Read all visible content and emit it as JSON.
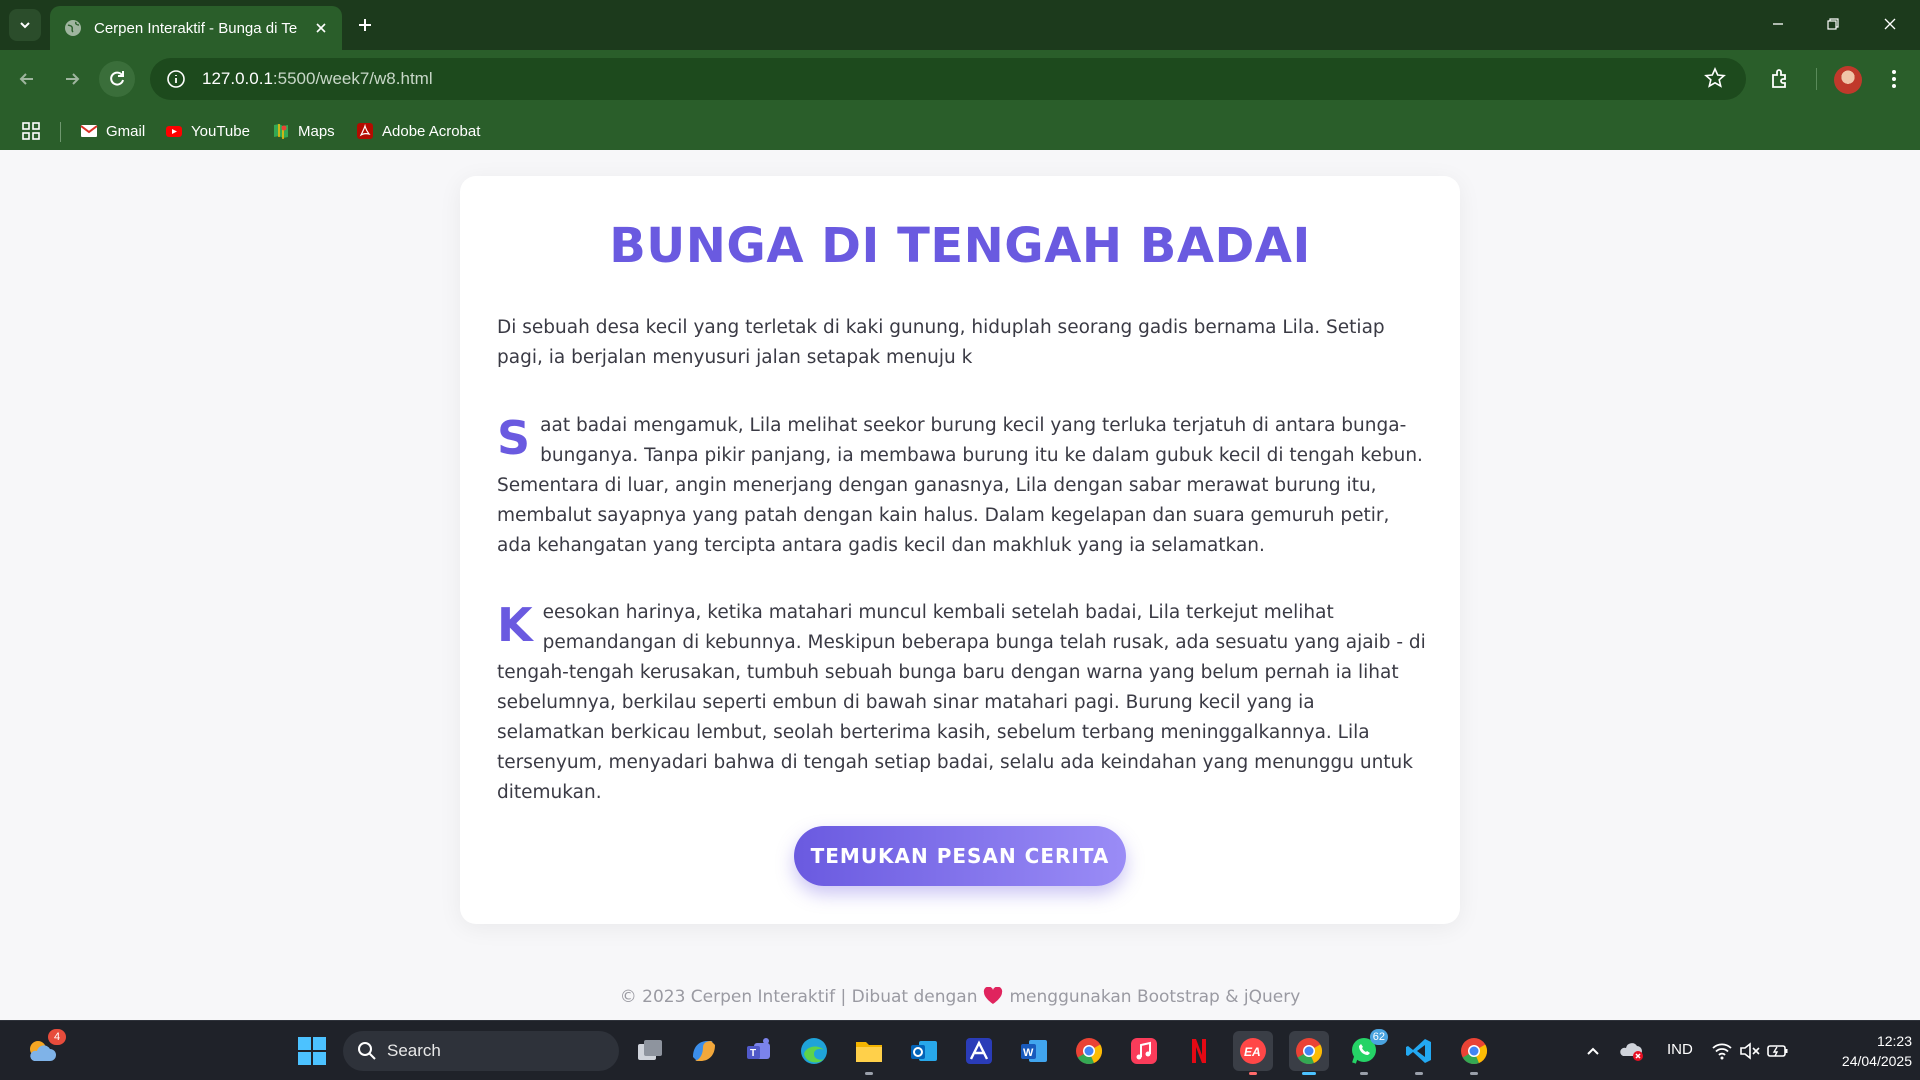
{
  "browser": {
    "tab_title": "Cerpen Interaktif - Bunga di Te",
    "url_host": "127.0.0.1",
    "url_path": ":5500/week7/w8.html",
    "bookmarks": [
      {
        "label": "Gmail",
        "icon": "gmail-icon"
      },
      {
        "label": "YouTube",
        "icon": "youtube-icon"
      },
      {
        "label": "Maps",
        "icon": "maps-icon"
      },
      {
        "label": "Adobe Acrobat",
        "icon": "acrobat-icon"
      }
    ]
  },
  "story": {
    "title": "BUNGA DI TENGAH BADAI",
    "paragraph1": "Di sebuah desa kecil yang terletak di kaki gunung, hiduplah seorang gadis bernama Lila. Setiap pagi, ia berjalan menyusuri jalan setapak menuju k",
    "paragraph2_dropcap": "S",
    "paragraph2": "aat badai mengamuk, Lila melihat seekor burung kecil yang terluka terjatuh di antara bunga-bunganya. Tanpa pikir panjang, ia membawa burung itu ke dalam gubuk kecil di tengah kebun. Sementara di luar, angin menerjang dengan ganasnya, Lila dengan sabar merawat burung itu, membalut sayapnya yang patah dengan kain halus. Dalam kegelapan dan suara gemuruh petir, ada kehangatan yang tercipta antara gadis kecil dan makhluk yang ia selamatkan.",
    "paragraph3_dropcap": "K",
    "paragraph3": "eesokan harinya, ketika matahari muncul kembali setelah badai, Lila terkejut melihat pemandangan di kebunnya. Meskipun beberapa bunga telah rusak, ada sesuatu yang ajaib - di tengah-tengah kerusakan, tumbuh sebuah bunga baru dengan warna yang belum pernah ia lihat sebelumnya, berkilau seperti embun di bawah sinar matahari pagi. Burung kecil yang ia selamatkan berkicau lembut, seolah berterima kasih, sebelum terbang meninggalkannya. Lila tersenyum, menyadari bahwa di tengah setiap badai, selalu ada keindahan yang menunggu untuk ditemukan.",
    "button_label": "TEMUKAN PESAN CERITA"
  },
  "footer": {
    "left": "© 2023 Cerpen Interaktif | Dibuat dengan",
    "right": "menggunakan Bootstrap & jQuery"
  },
  "taskbar": {
    "search_label": "Search",
    "weather_badge": "4",
    "whatsapp_badge": "62",
    "language": "IND",
    "time": "12:23",
    "date": "24/04/2025"
  },
  "colors": {
    "accent": "#6a5ae0",
    "browser_green": "#2a5e2a",
    "tab_dark_green": "#1c3a1c"
  }
}
